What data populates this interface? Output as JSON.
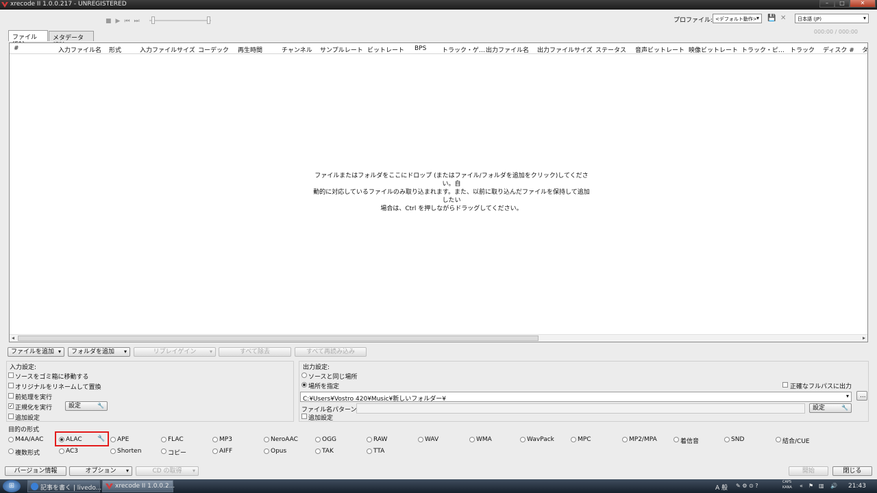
{
  "window": {
    "title": "xrecode II 1.0.0.217 - UNREGISTERED",
    "app_icon": "xrecode-icon"
  },
  "profile": {
    "label": "プロファイル:",
    "value": "<デフォルト動作>",
    "language": "日本語 (JP)",
    "time": "000:00 / 000:00"
  },
  "tabs": [
    {
      "label": "ファイル (F1)"
    },
    {
      "label": "メタデータ (F2)"
    }
  ],
  "columns": [
    "#",
    "入力ファイル名",
    "形式",
    "入力ファイルサイズ",
    "コーデック",
    "再生時間",
    "チャンネル",
    "サンプルレート",
    "ビットレート",
    "BPS",
    "トラック・ゲ…",
    "出力ファイル名",
    "出力ファイルサイズ",
    "ステータス",
    "音声ビットレート",
    "映像ビットレート",
    "トラック・ピ…",
    "トラック",
    "ディスク #",
    "タ"
  ],
  "empty_message": {
    "line1": "ファイルまたはフォルダをここにドロップ (またはファイル/フォルダを追加をクリック)してください。自",
    "line2": "動的に対応しているファイルのみ取り込まれます。また、以前に取り込んだファイルを保持して追加したい",
    "line3": "場合は、Ctrl を押しながらドラッグしてください。"
  },
  "toolbar": {
    "add_files": "ファイルを追加",
    "add_folder": "フォルダを追加",
    "replay_gain": "リプレイゲイン",
    "remove_all": "すべて除去",
    "reload_all": "すべて再読み込み"
  },
  "input_settings": {
    "title": "入力設定:",
    "move_to_trash": "ソースをゴミ箱に移動する",
    "rename_replace": "オリジナルをリネームして置換",
    "preprocess": "前処理を実行",
    "normalize": "正規化を実行",
    "settings_button": "設定",
    "additional": "追加設定"
  },
  "output_settings": {
    "title": "出力設定:",
    "same_location": "ソースと同じ場所",
    "specify_location": "場所を指定",
    "exact_fullpath": "正確なフルパスに出力",
    "path": "C:¥Users¥Vostro 420¥Music¥新しいフォルダー¥",
    "browse": "...",
    "filename_pattern_label": "ファイル名パターン:",
    "settings_button": "設定",
    "additional": "追加設定"
  },
  "formats": {
    "title": "目的の形式",
    "row1": [
      "M4A/AAC",
      "ALAC",
      "APE",
      "FLAC",
      "MP3",
      "NeroAAC",
      "OGG",
      "RAW",
      "WAV",
      "WMA",
      "WavPack",
      "MPC",
      "MP2/MPA",
      "着信音",
      "SND",
      "結合/CUE"
    ],
    "row2": [
      "複数形式",
      "AC3",
      "Shorten",
      "コピー",
      "AIFF",
      "Opus",
      "TAK",
      "TTA"
    ],
    "selected": "ALAC"
  },
  "bottom": {
    "version_info": "バージョン情報",
    "options": "オプション",
    "cd_get": "CD の取得",
    "start": "開始",
    "close": "閉じる"
  },
  "taskbar": {
    "tasks": [
      {
        "label": "記事を書く | livedo..."
      },
      {
        "label": "xrecode II 1.0.0.2..."
      }
    ],
    "ime": "A 般",
    "caps": "CAPS",
    "kana": "KANA",
    "clock": "21:43"
  }
}
